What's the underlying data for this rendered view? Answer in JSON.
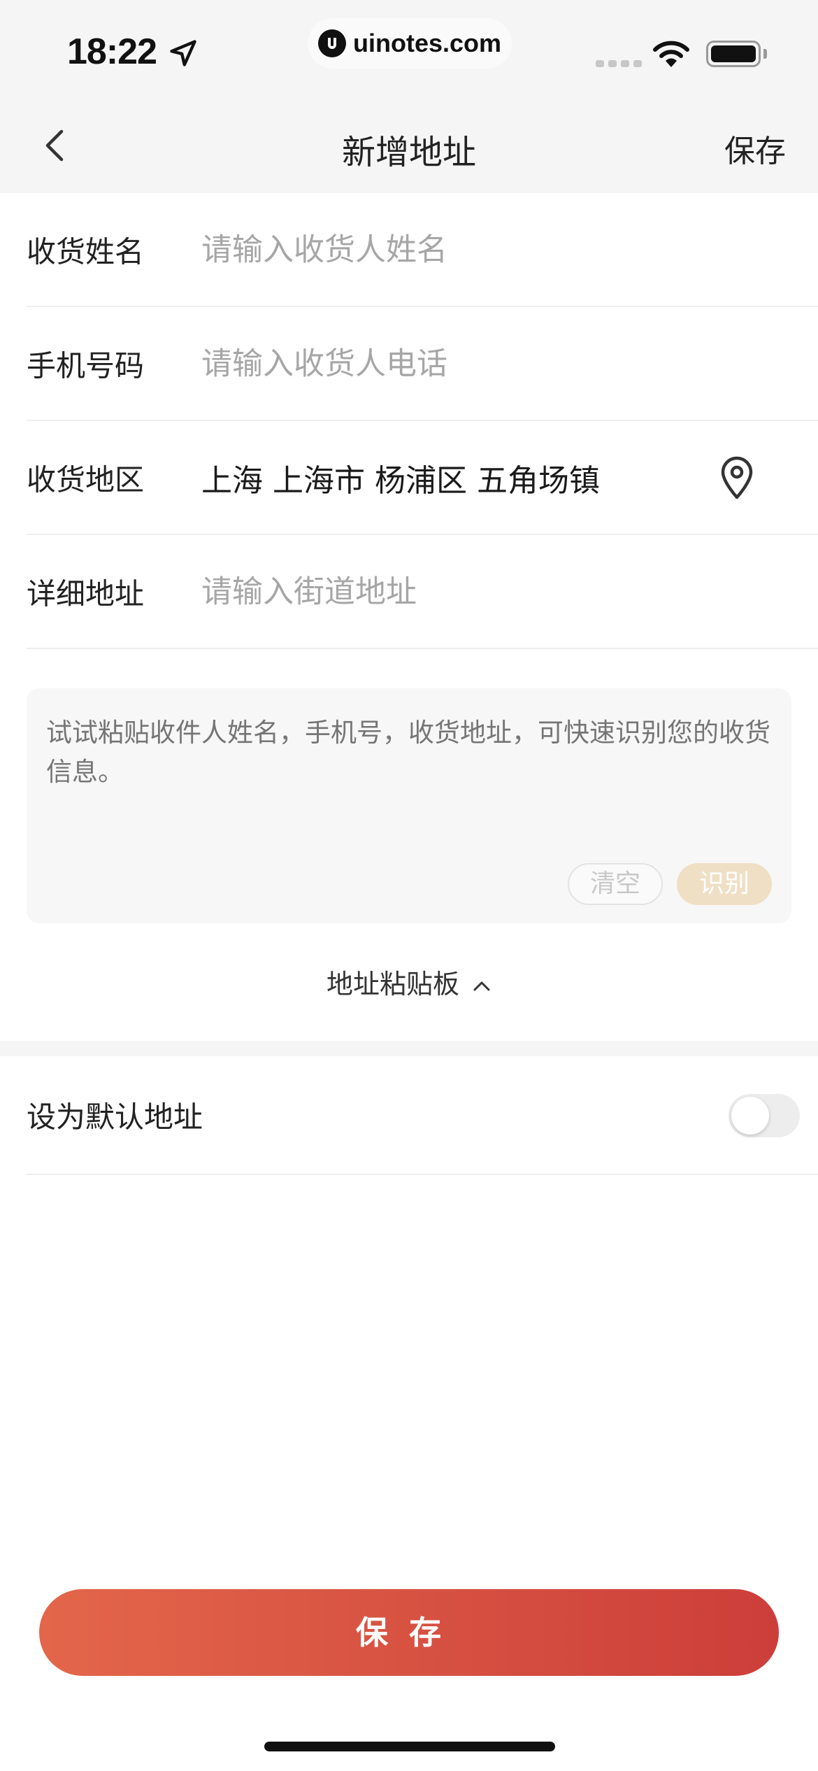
{
  "status_bar": {
    "time": "18:22",
    "watermark": "uinotes.com",
    "icons": [
      "location-arrow-icon",
      "signal-icon",
      "wifi-icon",
      "battery-icon"
    ]
  },
  "nav": {
    "title": "新增地址",
    "save_label": "保存",
    "back_icon": "chevron-left-icon"
  },
  "form": {
    "name": {
      "label": "收货姓名",
      "placeholder": "请输入收货人姓名",
      "value": ""
    },
    "phone": {
      "label": "手机号码",
      "placeholder": "请输入收货人电话",
      "value": ""
    },
    "region": {
      "label": "收货地区",
      "value": "上海 上海市 杨浦区 五角场镇",
      "icon": "location-pin-icon"
    },
    "detail": {
      "label": "详细地址",
      "placeholder": "请输入街道地址",
      "value": ""
    }
  },
  "paste_box": {
    "placeholder": "试试粘贴收件人姓名，手机号，收货地址，可快速识别您的收货信息。",
    "clear_label": "清空",
    "recognize_label": "识别"
  },
  "clipboard_toggle": {
    "label": "地址粘贴板",
    "icon": "chevron-up-icon"
  },
  "default_address": {
    "label": "设为默认地址",
    "enabled": false
  },
  "bottom_save": {
    "label": "保存"
  },
  "colors": {
    "accent_start": "#e3664a",
    "accent_end": "#cc3e3a",
    "recognize_bg": "#efdfc5",
    "placeholder": "#a6a6a6",
    "nav_bg": "#f5f5f5"
  }
}
